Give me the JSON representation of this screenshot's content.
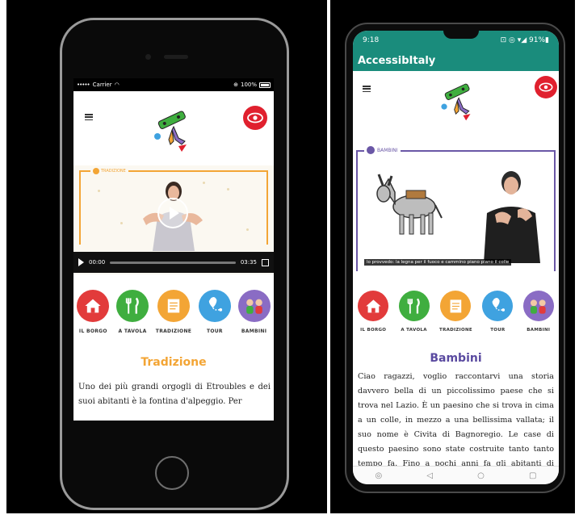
{
  "left_phone": {
    "status": {
      "carrier": "Carrier",
      "signal": "•••••",
      "battery": "100%"
    },
    "video": {
      "frame_label": "TRADIZIONE",
      "time_current": "00:00",
      "time_total": "03:35"
    },
    "nav": [
      {
        "label": "IL BORGO",
        "color": "#e23b3b",
        "icon": "home-icon"
      },
      {
        "label": "A TAVOLA",
        "color": "#3fae3f",
        "icon": "fork-knife-icon"
      },
      {
        "label": "TRADIZIONE",
        "color": "#f3a535",
        "icon": "scroll-icon"
      },
      {
        "label": "TOUR",
        "color": "#3fa2e0",
        "icon": "map-pin-icon"
      },
      {
        "label": "BAMBINI",
        "color": "#8a6cc4",
        "icon": "kids-icon"
      }
    ],
    "section_title": "Tradizione",
    "section_color": "#f3a535",
    "body": "Uno dei più grandi orgogli di Etroubles e dei suoi abitanti è la fontina d'alpeggio. Per"
  },
  "right_phone": {
    "status": {
      "time": "9:18",
      "icons": "⊡ ◎ ▾◢ 91%▮"
    },
    "app_title": "AccessibItaly",
    "brand_color": "#1a8c7c",
    "frame_label": "BAMBINI",
    "caption": "lo provvedo: la legna per il fuoco e cammino piano piano il colle",
    "nav": [
      {
        "label": "IL BORGO",
        "color": "#e23b3b",
        "icon": "home-icon"
      },
      {
        "label": "A TAVOLA",
        "color": "#3fae3f",
        "icon": "fork-knife-icon"
      },
      {
        "label": "TRADIZIONE",
        "color": "#f3a535",
        "icon": "scroll-icon"
      },
      {
        "label": "TOUR",
        "color": "#3fa2e0",
        "icon": "map-pin-icon"
      },
      {
        "label": "BAMBINI",
        "color": "#8a6cc4",
        "icon": "kids-icon"
      }
    ],
    "section_title": "Bambini",
    "section_color": "#5a4aa0",
    "body": "Ciao ragazzi, voglio raccontarvi una storia davvero bella di un piccolissimo paese che si trova nel Lazio. È un paesino che si trova in cima a un colle, in mezzo a una bellissima vallata; il suo nome è Civita di Bagnoregio. Le case di questo paesino sono state costruite tanto tanto tempo fa. Fino a pochi anni fa gli abitanti di Civita per",
    "bottom_nav": [
      "◎",
      "◁",
      "○",
      "▢"
    ]
  }
}
